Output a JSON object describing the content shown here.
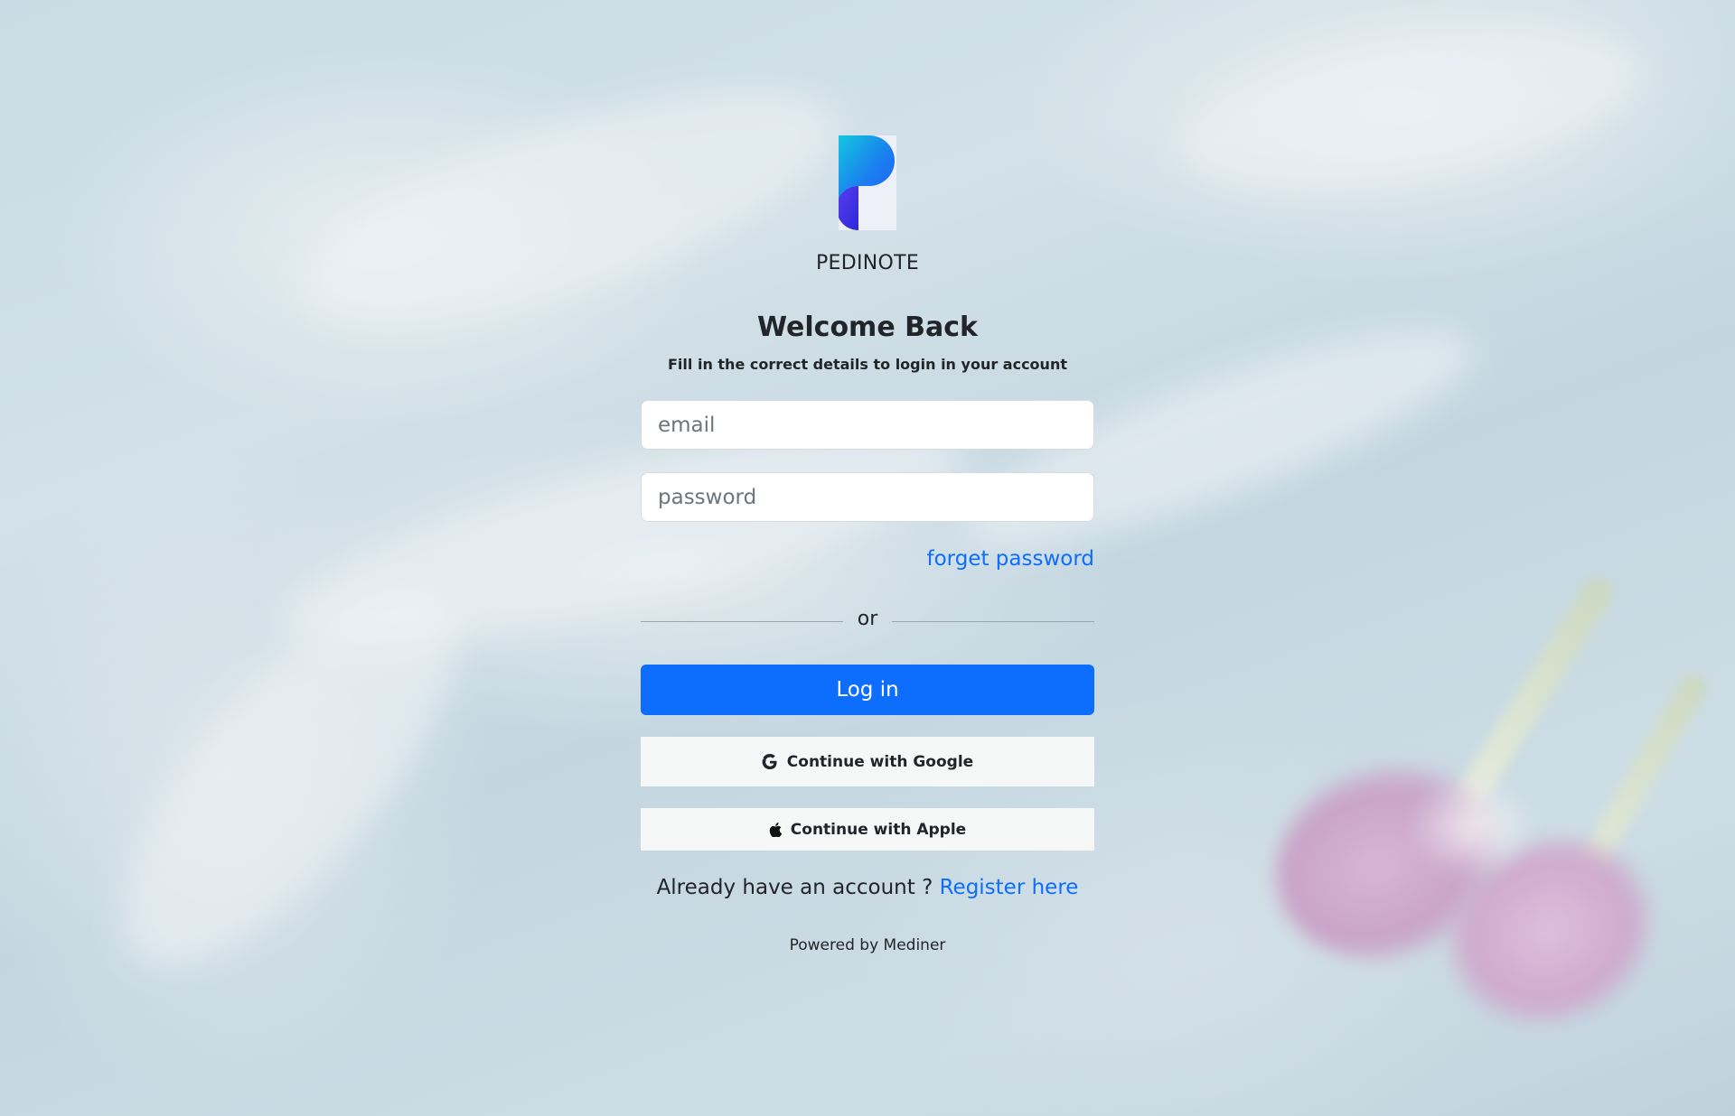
{
  "brand": {
    "name": "PEDINOTE",
    "logo_icon": "pedinote-p-logo-icon"
  },
  "login": {
    "title": "Welcome Back",
    "subtitle": "Fill in the correct details to login in your account",
    "email_placeholder": "email",
    "email_value": "",
    "password_placeholder": "password",
    "password_value": "",
    "forget_password": "forget password",
    "divider_text": "or",
    "login_button": "Log in",
    "google_button": "Continue with Google",
    "google_icon": "google-g-icon",
    "apple_button": "Continue with Apple",
    "apple_icon": "apple-icon",
    "register_prompt": "Already have an account ?",
    "register_link": "Register here",
    "powered_by": "Powered by Mediner"
  },
  "colors": {
    "primary": "#0d6efd",
    "text": "#212529",
    "social_button_bg": "#f6f7f7"
  }
}
